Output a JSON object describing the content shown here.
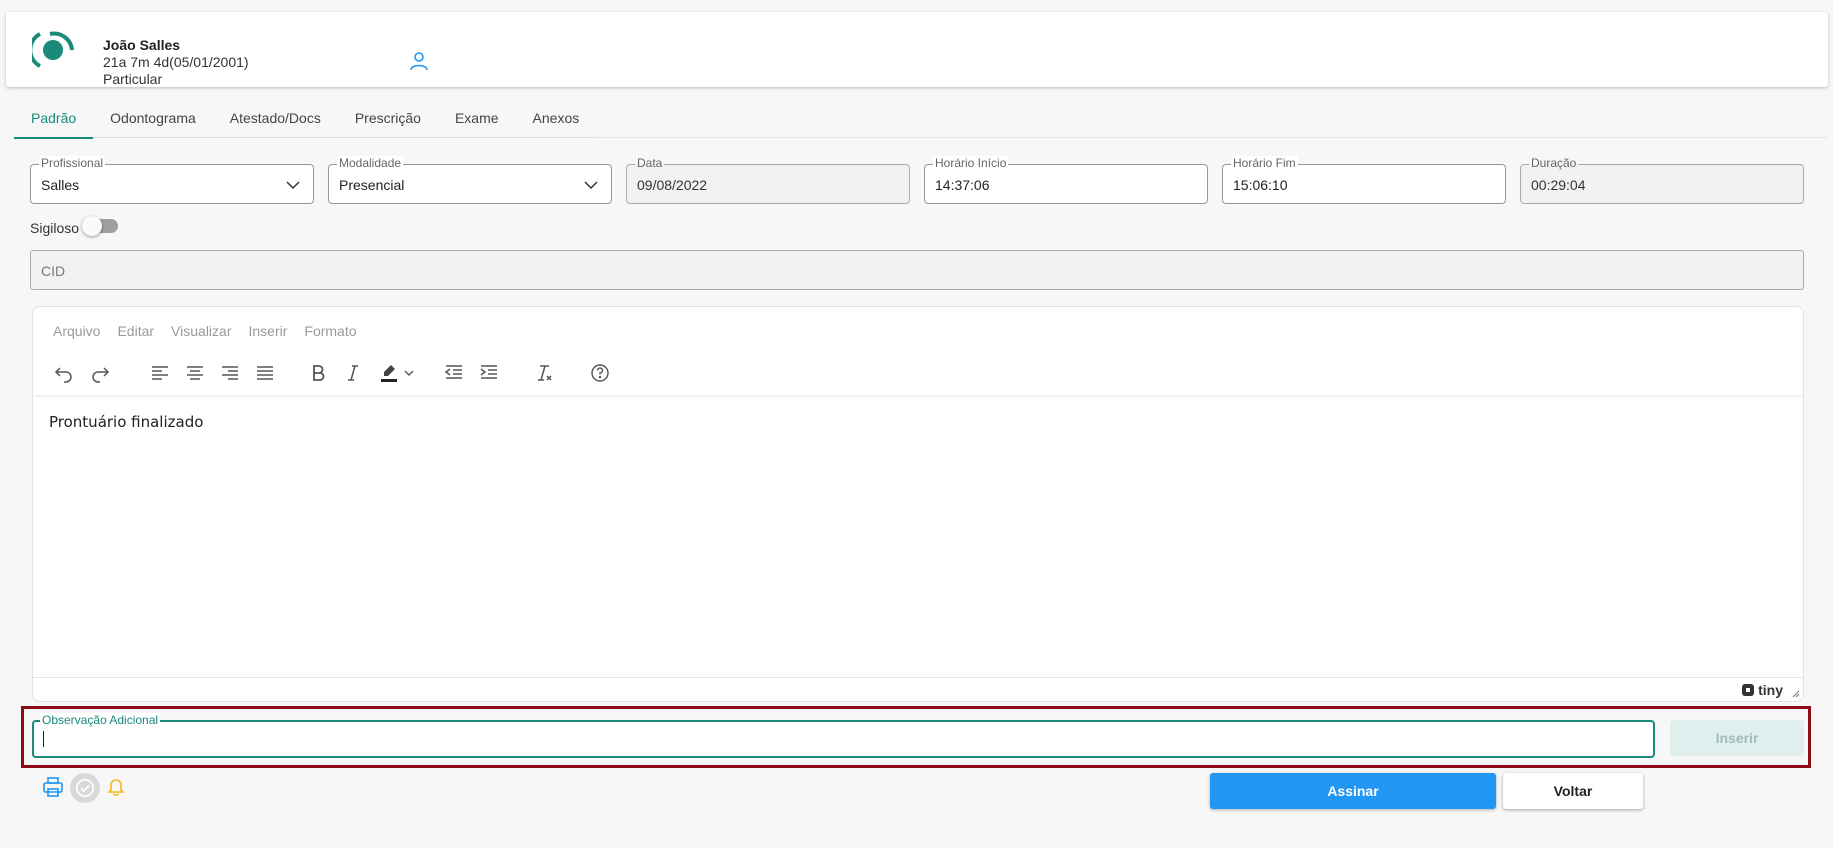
{
  "patient": {
    "name": "João Salles",
    "age": "21a 7m 4d(05/01/2001)",
    "plan": "Particular"
  },
  "tabs": [
    {
      "label": "Padrão",
      "active": true
    },
    {
      "label": "Odontograma",
      "active": false
    },
    {
      "label": "Atestado/Docs",
      "active": false
    },
    {
      "label": "Prescrição",
      "active": false
    },
    {
      "label": "Exame",
      "active": false
    },
    {
      "label": "Anexos",
      "active": false
    }
  ],
  "fields": {
    "profissional": {
      "label": "Profissional",
      "value": "Salles"
    },
    "modalidade": {
      "label": "Modalidade",
      "value": "Presencial"
    },
    "data": {
      "label": "Data",
      "value": "09/08/2022"
    },
    "horario_inicio": {
      "label": "Horário Início",
      "value": "14:37:06"
    },
    "horario_fim": {
      "label": "Horário Fim",
      "value": "15:06:10"
    },
    "duracao": {
      "label": "Duração",
      "value": "00:29:04"
    }
  },
  "sigiloso": {
    "label": "Sigiloso",
    "checked": false
  },
  "cid": {
    "placeholder": "CID"
  },
  "editor": {
    "menu": [
      "Arquivo",
      "Editar",
      "Visualizar",
      "Inserir",
      "Formato"
    ],
    "content": "Prontuário finalizado",
    "brand": "tiny"
  },
  "observacao": {
    "label": "Observação Adicional",
    "value": ""
  },
  "buttons": {
    "inserir": "Inserir",
    "assinar": "Assinar",
    "voltar": "Voltar"
  },
  "colors": {
    "accent": "#1a8a7a",
    "primary": "#2196f3",
    "highlight": "#8b0c16",
    "bell": "#f5b81c"
  }
}
